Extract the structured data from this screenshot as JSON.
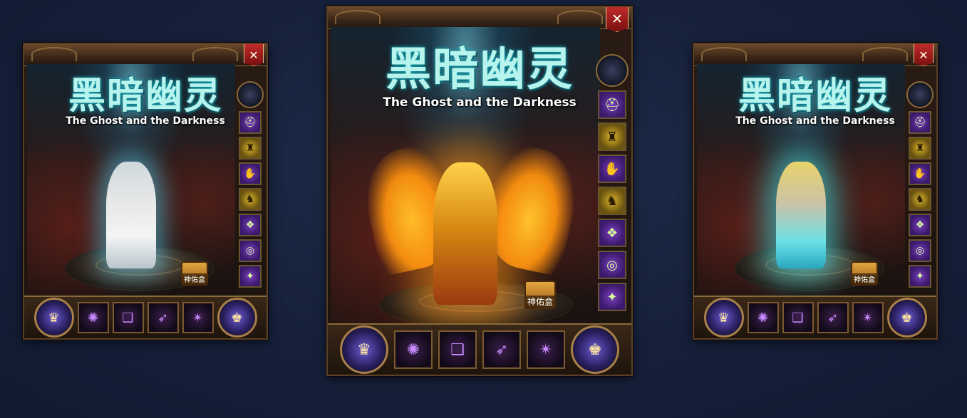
{
  "panels": [
    {
      "id": "left",
      "title_cn": "黑暗幽灵",
      "title_en": "The Ghost and the Darkness",
      "box_label": "神佑盒",
      "close_glyph": "✕"
    },
    {
      "id": "center",
      "title_cn": "黑暗幽灵",
      "title_en": "The Ghost and the Darkness",
      "box_label": "神佑盒",
      "close_glyph": "✕"
    },
    {
      "id": "right",
      "title_cn": "黑暗幽灵",
      "title_en": "The Ghost and the Darkness",
      "box_label": "神佑盒",
      "close_glyph": "✕"
    }
  ],
  "side_slots": [
    {
      "color": "purple",
      "icon": "helmet-icon",
      "glyph": "⛑"
    },
    {
      "color": "gold",
      "icon": "armor-icon",
      "glyph": "♜"
    },
    {
      "color": "purple",
      "icon": "gloves-icon",
      "glyph": "✋"
    },
    {
      "color": "gold",
      "icon": "boots-icon",
      "glyph": "♞"
    },
    {
      "color": "purple",
      "icon": "belt-icon",
      "glyph": "❖"
    },
    {
      "color": "purple",
      "icon": "ring-icon",
      "glyph": "◎"
    },
    {
      "color": "purple",
      "icon": "necklace-icon",
      "glyph": "✦"
    }
  ],
  "bottom_slots": [
    {
      "icon": "orb-icon",
      "glyph": "✺"
    },
    {
      "icon": "book-icon",
      "glyph": "❑"
    },
    {
      "icon": "weapon-icon",
      "glyph": "➶"
    },
    {
      "icon": "shuriken-icon",
      "glyph": "✴"
    }
  ],
  "round_left_glyph": "♛",
  "round_right_glyph": "♚"
}
